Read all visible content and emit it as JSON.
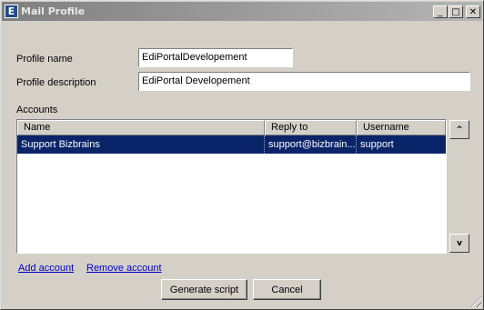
{
  "window": {
    "icon_letter": "E",
    "title": "Mail Profile",
    "controls": {
      "minimize": "_",
      "maximize": "□",
      "close": "✕"
    }
  },
  "form": {
    "profile_name_label": "Profile name",
    "profile_name_value": "EdiPortalDevelopement",
    "profile_description_label": "Profile description",
    "profile_description_value": "EdiPortal Developement"
  },
  "accounts": {
    "label": "Accounts",
    "columns": [
      "Name",
      "Reply to",
      "Username"
    ],
    "rows": [
      {
        "name": "Support Bizbrains",
        "reply_to": "support@bizbrain...",
        "username": "support",
        "selected": true
      }
    ],
    "move_up": "^",
    "move_down": "v"
  },
  "links": {
    "add_account": "Add account",
    "remove_account": "Remove account"
  },
  "buttons": {
    "generate_script": "Generate script",
    "cancel": "Cancel"
  },
  "colors": {
    "selection": "#0a246a",
    "link": "#0000cc",
    "dialog_bg": "#d4d0c8"
  }
}
